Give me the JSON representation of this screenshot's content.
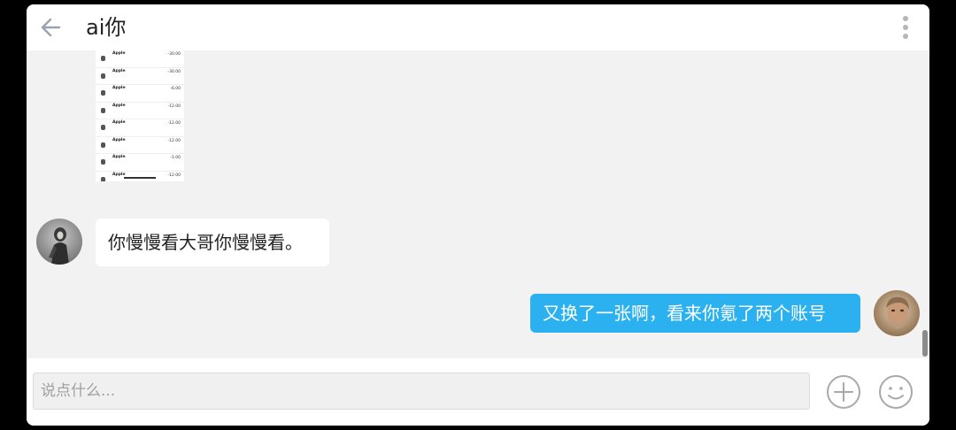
{
  "header": {
    "title": "ai你",
    "back_icon": "arrow-left-icon",
    "more_icon": "more-vertical-icon"
  },
  "image_message": {
    "rows": [
      {
        "name": "Apple",
        "date": "",
        "amount": "-30.00"
      },
      {
        "name": "Apple",
        "date": "",
        "amount": "-30.00"
      },
      {
        "name": "Apple",
        "date": "",
        "amount": "-6.00"
      },
      {
        "name": "Apple",
        "date": "",
        "amount": "-12.00"
      },
      {
        "name": "Apple",
        "date": "",
        "amount": "-12.00"
      },
      {
        "name": "Apple",
        "date": "",
        "amount": "-12.00"
      },
      {
        "name": "Apple",
        "date": "",
        "amount": "-1.00"
      },
      {
        "name": "Apple",
        "date": "",
        "amount": "-12.00"
      }
    ]
  },
  "messages": [
    {
      "side": "incoming",
      "text": "你慢慢看大哥你慢慢看。"
    },
    {
      "side": "outgoing",
      "text": "又换了一张啊，看来你氪了两个账号"
    }
  ],
  "input": {
    "placeholder": "说点什么...",
    "value": ""
  },
  "colors": {
    "accent": "#2bb1f0",
    "chat_background": "#f2f2f2"
  }
}
